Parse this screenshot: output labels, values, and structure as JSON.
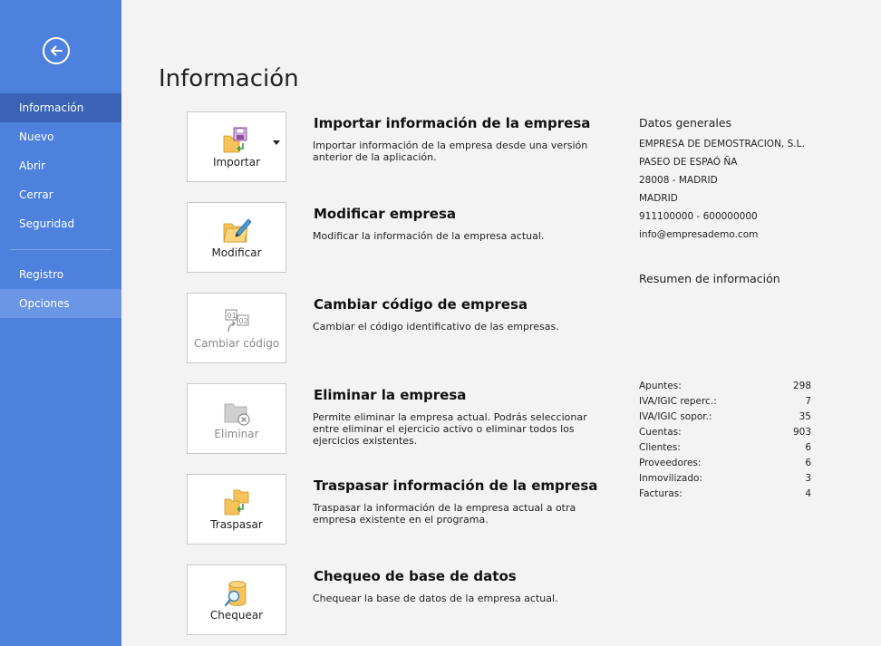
{
  "sidebar": {
    "items": [
      {
        "label": "Información"
      },
      {
        "label": "Nuevo"
      },
      {
        "label": "Abrir"
      },
      {
        "label": "Cerrar"
      },
      {
        "label": "Seguridad"
      },
      {
        "label": "Registro"
      },
      {
        "label": "Opciones"
      }
    ]
  },
  "page": {
    "title": "Información"
  },
  "actions": [
    {
      "tile_label": "Importar",
      "title": "Importar información de la empresa",
      "desc": "Importar información de la empresa desde una versión anterior de la aplicación."
    },
    {
      "tile_label": "Modificar",
      "title": "Modificar empresa",
      "desc": "Modificar la información de la empresa actual."
    },
    {
      "tile_label": "Cambiar código",
      "title": "Cambiar código de empresa",
      "desc": "Cambiar el código identificativo de las empresas."
    },
    {
      "tile_label": "Eliminar",
      "title": "Eliminar la empresa",
      "desc": "Permite eliminar la empresa actual. Podrás seleccionar entre eliminar el ejercicio activo o eliminar todos los ejercicios existentes."
    },
    {
      "tile_label": "Traspasar",
      "title": "Traspasar información de la empresa",
      "desc": "Traspasar la información de la empresa actual a otra empresa existente en el programa."
    },
    {
      "tile_label": "Chequear",
      "title": "Chequeo de base de datos",
      "desc": "Chequear la base de datos de la empresa actual."
    }
  ],
  "info": {
    "header": "Datos generales",
    "lines": [
      "EMPRESA DE DEMOSTRACION, S.L.",
      "PASEO DE ESPAÓ ÑA",
      "28008 - MADRID",
      "MADRID",
      "911100000 - 600000000",
      "info@empresademo.com"
    ],
    "summary_header": "Resumen de información"
  },
  "stats": [
    {
      "label": "Apuntes:",
      "value": "298"
    },
    {
      "label": "IVA/IGIC reperc.:",
      "value": "7"
    },
    {
      "label": "IVA/IGIC sopor.:",
      "value": "35"
    },
    {
      "label": "Cuentas:",
      "value": "903"
    },
    {
      "label": "Clientes:",
      "value": "6"
    },
    {
      "label": "Proveedores:",
      "value": "6"
    },
    {
      "label": "Inmovilizado:",
      "value": "3"
    },
    {
      "label": "Facturas:",
      "value": "4"
    }
  ],
  "colors": {
    "sidebar": "#4e80de",
    "sidebar_active": "#3a63b6",
    "sidebar_hover": "#6b96e6",
    "background": "#f3f3f3"
  }
}
